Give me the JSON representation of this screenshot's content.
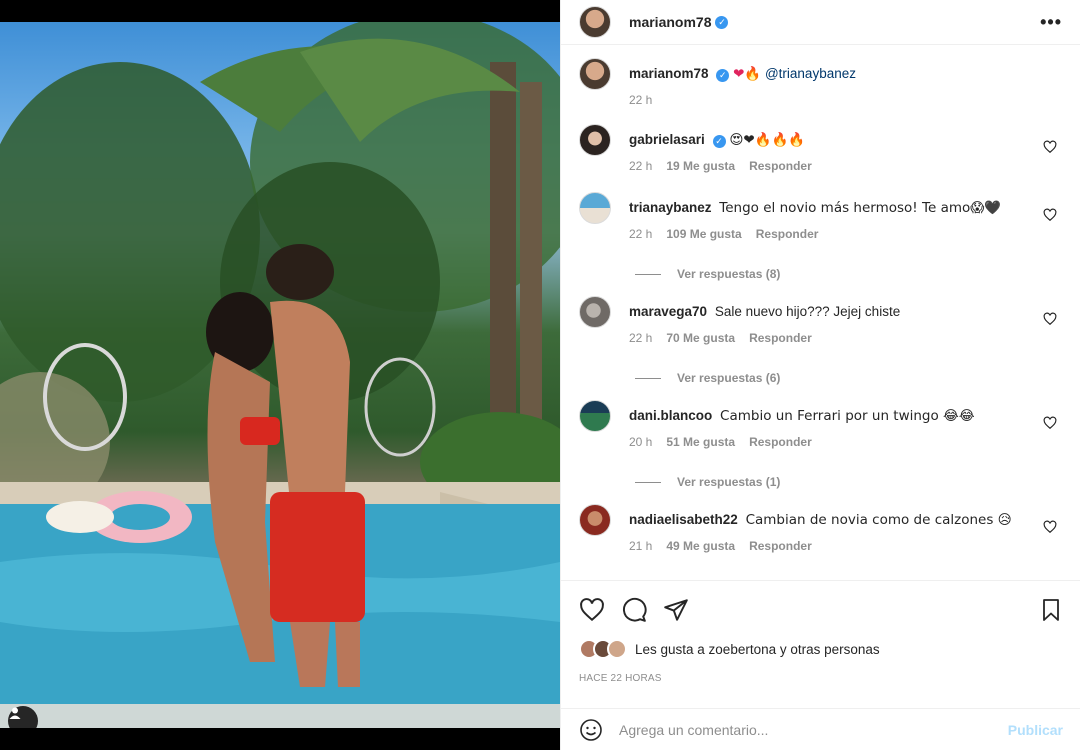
{
  "header": {
    "username": "marianom78",
    "more_label": "•••"
  },
  "caption": {
    "username": "marianom78",
    "emojis": "❤🔥",
    "mention": "@trianaybanez",
    "time": "22 h"
  },
  "comments": [
    {
      "username": "gabrielasari",
      "verified": true,
      "text": "😍❤🔥🔥🔥",
      "time": "22 h",
      "likes": "19 Me gusta",
      "reply": "Responder"
    },
    {
      "username": "trianaybanez",
      "verified": false,
      "text": "Tengo el novio más hermoso! Te amo😱🖤",
      "time": "22 h",
      "likes": "109 Me gusta",
      "reply": "Responder",
      "replies": "Ver respuestas (8)"
    },
    {
      "username": "maravega70",
      "verified": false,
      "text": "Sale nuevo hijo??? Jejej chiste",
      "time": "22 h",
      "likes": "70 Me gusta",
      "reply": "Responder",
      "replies": "Ver respuestas (6)"
    },
    {
      "username": "dani.blancoo",
      "verified": false,
      "text": "Cambio un Ferrari por un twingo 😂😂",
      "time": "20 h",
      "likes": "51 Me gusta",
      "reply": "Responder",
      "replies": "Ver respuestas (1)"
    },
    {
      "username": "nadiaelisabeth22",
      "verified": false,
      "text": "Cambian de novia como de calzones 😥",
      "time": "21 h",
      "likes": "49 Me gusta",
      "reply": "Responder"
    }
  ],
  "likes_summary": "Les gusta a zoebertona y otras personas",
  "post_timestamp": "HACE 22 HORAS",
  "add_comment": {
    "emoji_icon": "smiley-icon",
    "placeholder": "Agrega un comentario...",
    "publish_label": "Publicar"
  },
  "colors": {
    "verified": "#3897f0",
    "link": "#00376b",
    "publish_disabled": "#b2dffc",
    "secondary_text": "#8e8e8e"
  }
}
